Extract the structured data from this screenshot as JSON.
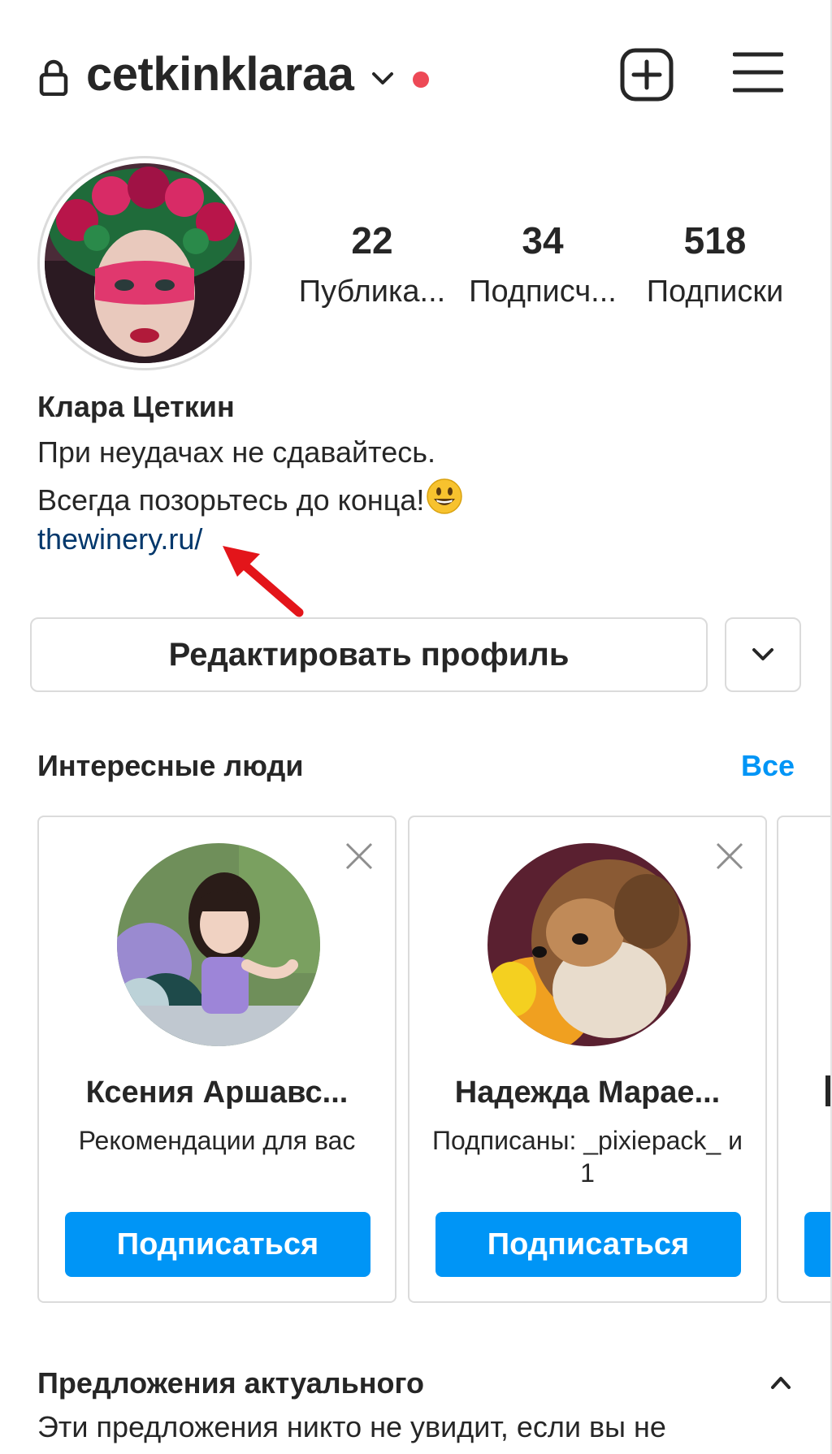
{
  "header": {
    "username": "cetkinklaraa",
    "lock_icon": "lock-icon",
    "dropdown_icon": "chevron-down-icon",
    "notification_dot_color": "#ed4956",
    "new_post_icon": "plus-square-icon",
    "menu_icon": "hamburger-menu-icon"
  },
  "profile": {
    "stats": [
      {
        "value": "22",
        "label": "Публика..."
      },
      {
        "value": "34",
        "label": "Подписч..."
      },
      {
        "value": "518",
        "label": "Подписки"
      }
    ],
    "full_name": "Клара Цеткин",
    "bio_line1": "При неудачах не сдавайтесь.",
    "bio_line2": "Всегда позорьтесь до конца!",
    "bio_emoji": "smiling-face-emoji",
    "link": "thewinery.ru/"
  },
  "actions": {
    "edit_profile": "Редактировать профиль",
    "more_icon": "chevron-down-icon"
  },
  "suggestions": {
    "title": "Интересные люди",
    "see_all": "Все",
    "cards": [
      {
        "name": "Ксения Аршавс...",
        "subtitle": "Рекомендации для вас",
        "button": "Подписаться"
      },
      {
        "name": "Надежда Марае...",
        "subtitle": "Подписаны: _pixiepack_ и 1",
        "button": "Подписаться"
      }
    ]
  },
  "highlights": {
    "title": "Предложения актуального",
    "description": "Эти предложения никто не увидит, если вы не"
  },
  "colors": {
    "accent": "#0095f6",
    "link": "#00376b",
    "border": "#dbdbdb",
    "text": "#262626",
    "arrow": "#e3151a"
  }
}
